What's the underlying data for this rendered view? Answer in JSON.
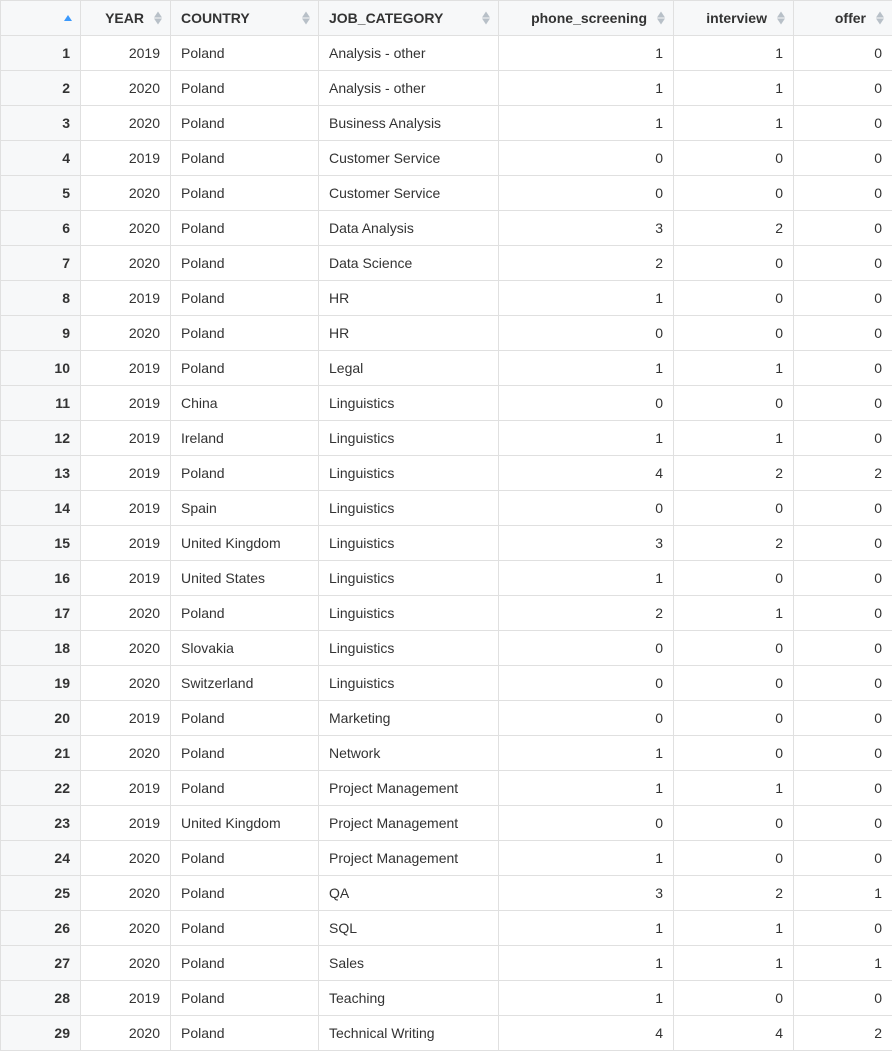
{
  "columns": {
    "index": "",
    "year": "YEAR",
    "country": "COUNTRY",
    "job_category": "JOB_CATEGORY",
    "phone_screening": "phone_screening",
    "interview": "interview",
    "offer": "offer"
  },
  "rows": [
    {
      "idx": "1",
      "year": "2019",
      "country": "Poland",
      "job": "Analysis - other",
      "phone": "1",
      "interview": "1",
      "offer": "0"
    },
    {
      "idx": "2",
      "year": "2020",
      "country": "Poland",
      "job": "Analysis - other",
      "phone": "1",
      "interview": "1",
      "offer": "0"
    },
    {
      "idx": "3",
      "year": "2020",
      "country": "Poland",
      "job": "Business Analysis",
      "phone": "1",
      "interview": "1",
      "offer": "0"
    },
    {
      "idx": "4",
      "year": "2019",
      "country": "Poland",
      "job": "Customer Service",
      "phone": "0",
      "interview": "0",
      "offer": "0"
    },
    {
      "idx": "5",
      "year": "2020",
      "country": "Poland",
      "job": "Customer Service",
      "phone": "0",
      "interview": "0",
      "offer": "0"
    },
    {
      "idx": "6",
      "year": "2020",
      "country": "Poland",
      "job": "Data Analysis",
      "phone": "3",
      "interview": "2",
      "offer": "0"
    },
    {
      "idx": "7",
      "year": "2020",
      "country": "Poland",
      "job": "Data Science",
      "phone": "2",
      "interview": "0",
      "offer": "0"
    },
    {
      "idx": "8",
      "year": "2019",
      "country": "Poland",
      "job": "HR",
      "phone": "1",
      "interview": "0",
      "offer": "0"
    },
    {
      "idx": "9",
      "year": "2020",
      "country": "Poland",
      "job": "HR",
      "phone": "0",
      "interview": "0",
      "offer": "0"
    },
    {
      "idx": "10",
      "year": "2019",
      "country": "Poland",
      "job": "Legal",
      "phone": "1",
      "interview": "1",
      "offer": "0"
    },
    {
      "idx": "11",
      "year": "2019",
      "country": "China",
      "job": "Linguistics",
      "phone": "0",
      "interview": "0",
      "offer": "0"
    },
    {
      "idx": "12",
      "year": "2019",
      "country": "Ireland",
      "job": "Linguistics",
      "phone": "1",
      "interview": "1",
      "offer": "0"
    },
    {
      "idx": "13",
      "year": "2019",
      "country": "Poland",
      "job": "Linguistics",
      "phone": "4",
      "interview": "2",
      "offer": "2"
    },
    {
      "idx": "14",
      "year": "2019",
      "country": "Spain",
      "job": "Linguistics",
      "phone": "0",
      "interview": "0",
      "offer": "0"
    },
    {
      "idx": "15",
      "year": "2019",
      "country": "United Kingdom",
      "job": "Linguistics",
      "phone": "3",
      "interview": "2",
      "offer": "0"
    },
    {
      "idx": "16",
      "year": "2019",
      "country": "United States",
      "job": "Linguistics",
      "phone": "1",
      "interview": "0",
      "offer": "0"
    },
    {
      "idx": "17",
      "year": "2020",
      "country": "Poland",
      "job": "Linguistics",
      "phone": "2",
      "interview": "1",
      "offer": "0"
    },
    {
      "idx": "18",
      "year": "2020",
      "country": "Slovakia",
      "job": "Linguistics",
      "phone": "0",
      "interview": "0",
      "offer": "0"
    },
    {
      "idx": "19",
      "year": "2020",
      "country": "Switzerland",
      "job": "Linguistics",
      "phone": "0",
      "interview": "0",
      "offer": "0"
    },
    {
      "idx": "20",
      "year": "2019",
      "country": "Poland",
      "job": "Marketing",
      "phone": "0",
      "interview": "0",
      "offer": "0"
    },
    {
      "idx": "21",
      "year": "2020",
      "country": "Poland",
      "job": "Network",
      "phone": "1",
      "interview": "0",
      "offer": "0"
    },
    {
      "idx": "22",
      "year": "2019",
      "country": "Poland",
      "job": "Project Management",
      "phone": "1",
      "interview": "1",
      "offer": "0"
    },
    {
      "idx": "23",
      "year": "2019",
      "country": "United Kingdom",
      "job": "Project Management",
      "phone": "0",
      "interview": "0",
      "offer": "0"
    },
    {
      "idx": "24",
      "year": "2020",
      "country": "Poland",
      "job": "Project Management",
      "phone": "1",
      "interview": "0",
      "offer": "0"
    },
    {
      "idx": "25",
      "year": "2020",
      "country": "Poland",
      "job": "QA",
      "phone": "3",
      "interview": "2",
      "offer": "1"
    },
    {
      "idx": "26",
      "year": "2020",
      "country": "Poland",
      "job": "SQL",
      "phone": "1",
      "interview": "1",
      "offer": "0"
    },
    {
      "idx": "27",
      "year": "2020",
      "country": "Poland",
      "job": "Sales",
      "phone": "1",
      "interview": "1",
      "offer": "1"
    },
    {
      "idx": "28",
      "year": "2019",
      "country": "Poland",
      "job": "Teaching",
      "phone": "1",
      "interview": "0",
      "offer": "0"
    },
    {
      "idx": "29",
      "year": "2020",
      "country": "Poland",
      "job": "Technical Writing",
      "phone": "4",
      "interview": "4",
      "offer": "2"
    }
  ]
}
